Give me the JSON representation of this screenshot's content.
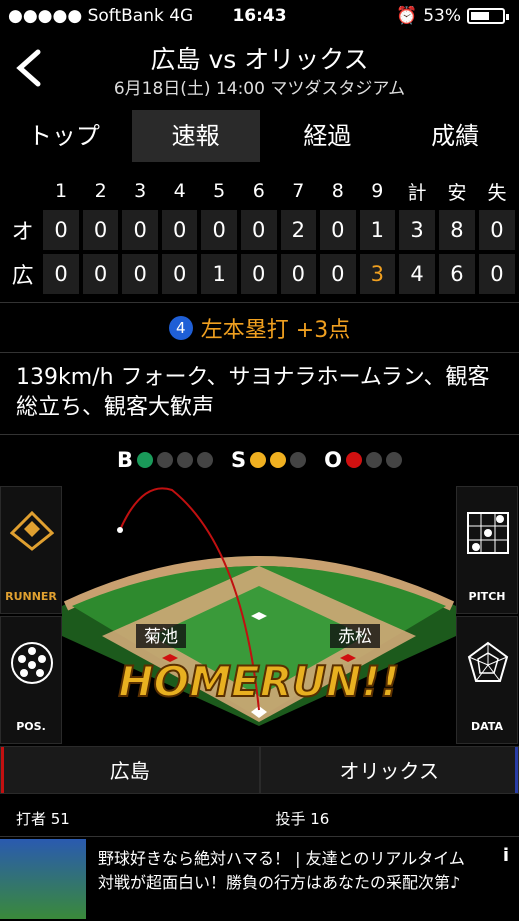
{
  "status": {
    "carrier": "●●●●● SoftBank  4G",
    "time": "16:43",
    "battery": "53%"
  },
  "header": {
    "title": "広島 vs オリックス",
    "subtitle": "6月18日(土) 14:00 マツダスタジアム"
  },
  "tabs": [
    {
      "label": "トップ"
    },
    {
      "label": "速報"
    },
    {
      "label": "経過"
    },
    {
      "label": "成績"
    }
  ],
  "scoreboard": {
    "headers": [
      "1",
      "2",
      "3",
      "4",
      "5",
      "6",
      "7",
      "8",
      "9",
      "計",
      "安",
      "失"
    ],
    "rows": [
      {
        "team": "オ",
        "cells": [
          "0",
          "0",
          "0",
          "0",
          "0",
          "0",
          "2",
          "0",
          "1",
          "3",
          "8",
          "0"
        ]
      },
      {
        "team": "広",
        "cells": [
          "0",
          "0",
          "0",
          "0",
          "1",
          "0",
          "0",
          "0",
          "3",
          "4",
          "6",
          "0"
        ]
      }
    ]
  },
  "result": {
    "batter_number": "4",
    "text": "左本塁打 +3点"
  },
  "description": "139km/h フォーク、サヨナラホームラン、観客総立ち、観客大歓声",
  "count": {
    "b_label": "B",
    "s_label": "S",
    "o_label": "O",
    "balls": 1,
    "strikes": 2,
    "outs": 1,
    "colors": {
      "ball": "#1a9a5a",
      "strike": "#f0b020",
      "out": "#d01010",
      "off": "#444"
    }
  },
  "side_buttons": {
    "runner": "RUNNER",
    "pos": "POS.",
    "pitch": "PITCH",
    "data": "DATA"
  },
  "field": {
    "left_label": "菊池",
    "right_label": "赤松",
    "banner": "HOMERUN!!"
  },
  "team_tabs": {
    "home": "広島",
    "away": "オリックス"
  },
  "players": {
    "batter": "打者  51",
    "pitcher": "投手  16"
  },
  "ad": {
    "text": "野球好きなら絶対ハマる！ | 友達とのリアルタイム対戦が超面白い！勝負の行方はあなたの采配次第♪",
    "info": "i"
  }
}
